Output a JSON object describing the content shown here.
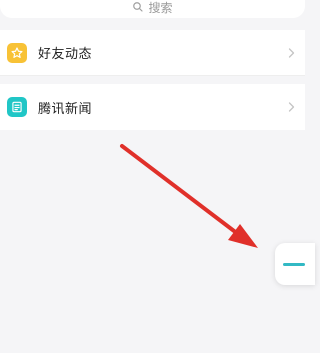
{
  "search": {
    "placeholder": "搜索",
    "icon": "search-icon"
  },
  "list": {
    "items": [
      {
        "label": "好友动态",
        "icon": "star-badge-icon",
        "icon_color": "#f8c236"
      },
      {
        "label": "腾讯新闻",
        "icon": "news-icon",
        "icon_color": "#20c6c6"
      }
    ]
  },
  "overlay": {
    "arrow_color": "#e0302a"
  },
  "side_handle": {
    "accent": "#32b9c4"
  }
}
